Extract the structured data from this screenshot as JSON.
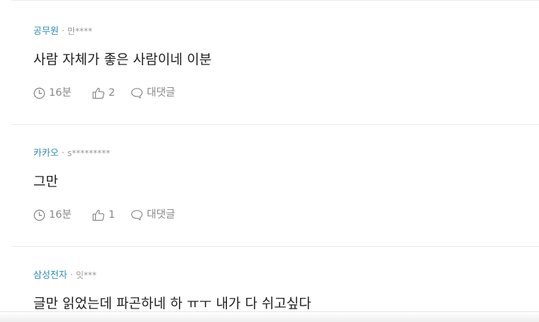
{
  "comments": [
    {
      "company": "공무원",
      "separator": "·",
      "nickname": "만****",
      "text": "사람 자체가 좋은 사람이네 이분",
      "time": "16분",
      "likes": "2",
      "reply_label": "대댓글"
    },
    {
      "company": "카카오",
      "separator": "·",
      "nickname": "s*********",
      "text": "그만",
      "time": "16분",
      "likes": "1",
      "reply_label": "대댓글"
    },
    {
      "company": "삼성전자",
      "separator": "·",
      "nickname": "잇***",
      "text": "글만 읽었는데 파곤하네 하 ㅠㅜ 내가 다 쉬고싶다"
    }
  ],
  "colors": {
    "company": "#2d8db5",
    "meta": "#999999",
    "body": "#1f1f1f",
    "action": "#888888",
    "divider": "#ececec"
  },
  "icons": {
    "time": "clock-icon",
    "like": "thumbs-up-icon",
    "reply": "speech-bubble-icon"
  }
}
